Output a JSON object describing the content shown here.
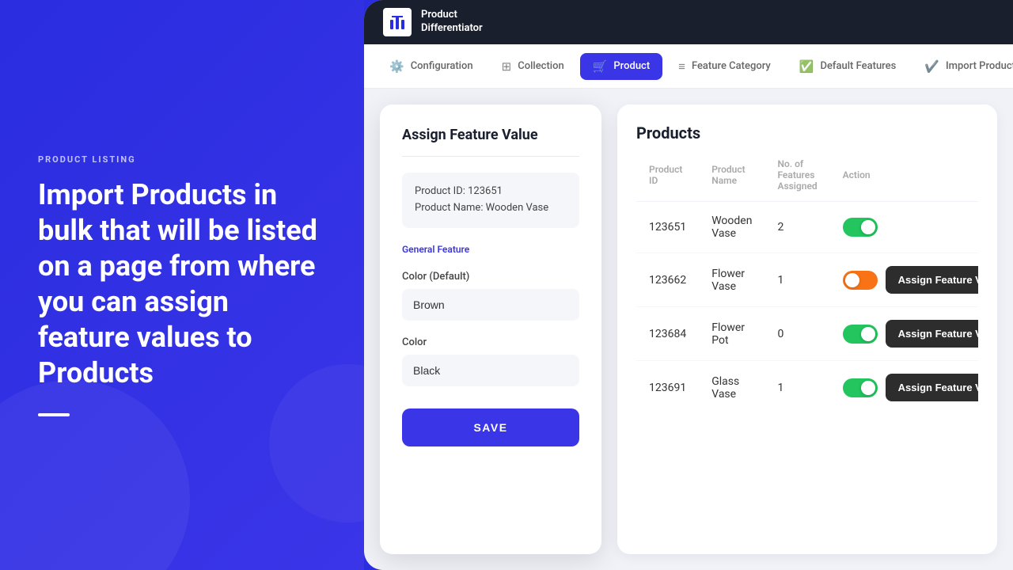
{
  "left": {
    "label": "PRODUCT LISTING",
    "title": "Import Products in bulk that will be listed on a page from where you can assign feature values to Products"
  },
  "topbar": {
    "logo_text_line1": "Product",
    "logo_text_line2": "Differentiator"
  },
  "nav": {
    "items": [
      {
        "id": "configuration",
        "label": "Configuration",
        "icon": "⚙"
      },
      {
        "id": "collection",
        "label": "Collection",
        "icon": "⊞"
      },
      {
        "id": "product",
        "label": "Product",
        "icon": "🛒",
        "active": true
      },
      {
        "id": "feature-category",
        "label": "Feature Category",
        "icon": "≡"
      },
      {
        "id": "default-features",
        "label": "Default Features",
        "icon": "✓≡"
      },
      {
        "id": "import-products",
        "label": "Import Products",
        "icon": "✓"
      }
    ]
  },
  "modal": {
    "title": "Assign Feature Value",
    "product_id_label": "Product ID: 123651",
    "product_name_label": "Product Name: Wooden Vase",
    "feature_section": "General Feature",
    "color_default_label": "Color (Default)",
    "color_default_value": "Brown",
    "color_label": "Color",
    "color_value": "Black",
    "save_label": "SAVE"
  },
  "products_table": {
    "title": "Products",
    "columns": [
      "Product ID",
      "Product Name",
      "No. of Features Assigned",
      "Action"
    ],
    "rows": [
      {
        "id": "123651",
        "name": "Wooden Vase",
        "features": "2",
        "toggle": "on",
        "has_assign": false
      },
      {
        "id": "123662",
        "name": "Flower Vase",
        "features": "1",
        "toggle": "off",
        "has_assign": true,
        "assign_label": "Assign Feature Value"
      },
      {
        "id": "123684",
        "name": "Flower Pot",
        "features": "0",
        "toggle": "on",
        "has_assign": true,
        "assign_label": "Assign Feature Value"
      },
      {
        "id": "123691",
        "name": "Glass Vase",
        "features": "1",
        "toggle": "on",
        "has_assign": true,
        "assign_label": "Assign Feature Value"
      }
    ]
  }
}
